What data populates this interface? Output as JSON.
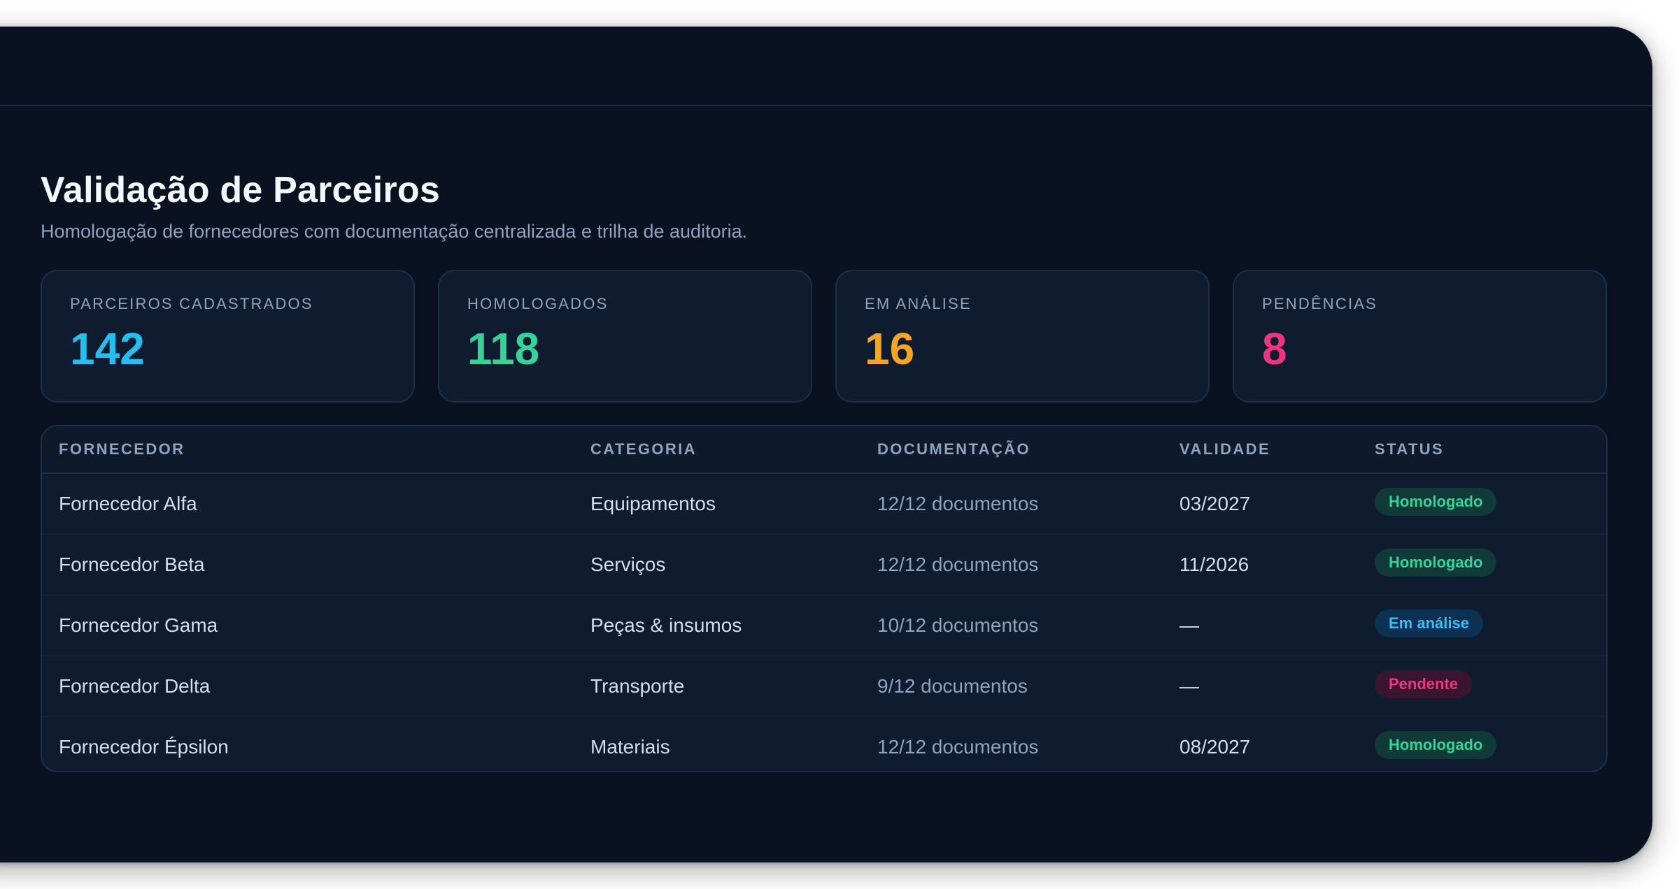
{
  "header": {
    "title": "Validação de Parceiros",
    "subtitle": "Homologação de fornecedores com documentação centralizada e trilha de auditoria."
  },
  "colors": {
    "accent_blue": "#22c0f0",
    "accent_green": "#34d399",
    "accent_amber": "#f5a524",
    "accent_pink": "#f0357e",
    "background": "#0a1120",
    "card": "#0f1b2f"
  },
  "stats": [
    {
      "label": "PARCEIROS CADASTRADOS",
      "value": "142",
      "color": "#22c0f0"
    },
    {
      "label": "HOMOLOGADOS",
      "value": "118",
      "color": "#34d399"
    },
    {
      "label": "EM ANÁLISE",
      "value": "16",
      "color": "#f5a524"
    },
    {
      "label": "PENDÊNCIAS",
      "value": "8",
      "color": "#f0357e"
    }
  ],
  "table": {
    "columns": [
      "FORNECEDOR",
      "CATEGORIA",
      "DOCUMENTAÇÃO",
      "VALIDADE",
      "STATUS"
    ],
    "rows": [
      {
        "fornecedor": "Fornecedor Alfa",
        "categoria": "Equipamentos",
        "documentacao": "12/12 documentos",
        "validade": "03/2027",
        "status": "Homologado"
      },
      {
        "fornecedor": "Fornecedor Beta",
        "categoria": "Serviços",
        "documentacao": "12/12 documentos",
        "validade": "11/2026",
        "status": "Homologado"
      },
      {
        "fornecedor": "Fornecedor Gama",
        "categoria": "Peças & insumos",
        "documentacao": "10/12 documentos",
        "validade": "—",
        "status": "Em análise"
      },
      {
        "fornecedor": "Fornecedor Delta",
        "categoria": "Transporte",
        "documentacao": "9/12 documentos",
        "validade": "—",
        "status": "Pendente"
      },
      {
        "fornecedor": "Fornecedor Épsilon",
        "categoria": "Materiais",
        "documentacao": "12/12 documentos",
        "validade": "08/2027",
        "status": "Homologado"
      }
    ]
  }
}
